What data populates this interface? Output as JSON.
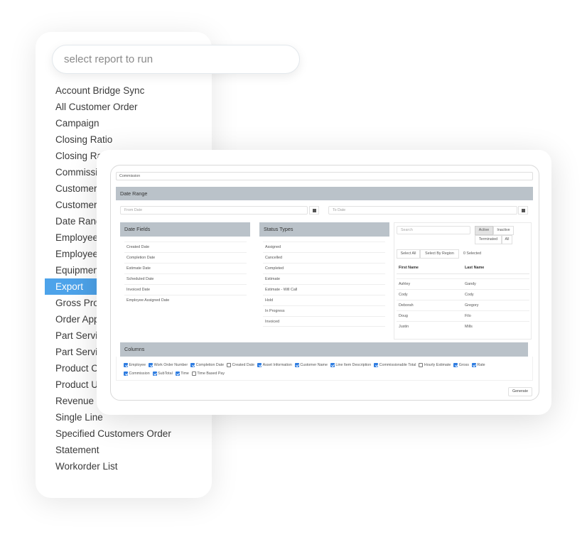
{
  "report_picker": {
    "search_placeholder": "select report to run",
    "items": [
      {
        "label": "Account Bridge Sync",
        "active": false
      },
      {
        "label": "All Customer Order",
        "active": false
      },
      {
        "label": "Campaign",
        "active": false
      },
      {
        "label": "Closing Ratio",
        "active": false
      },
      {
        "label": "Closing Ratio",
        "active": false
      },
      {
        "label": "Commission",
        "active": false
      },
      {
        "label": "Customer",
        "active": false
      },
      {
        "label": "Customers",
        "active": false
      },
      {
        "label": "Date Range",
        "active": false
      },
      {
        "label": "Employee",
        "active": false
      },
      {
        "label": "Employee",
        "active": false
      },
      {
        "label": "Equipment",
        "active": false
      },
      {
        "label": "Export",
        "active": true
      },
      {
        "label": "Gross Profit",
        "active": false
      },
      {
        "label": "Order App",
        "active": false
      },
      {
        "label": "Part Service",
        "active": false
      },
      {
        "label": "Part Service",
        "active": false
      },
      {
        "label": "Product Co",
        "active": false
      },
      {
        "label": "Product Us",
        "active": false
      },
      {
        "label": "Revenue",
        "active": false
      },
      {
        "label": "Single Line",
        "active": false
      },
      {
        "label": "Specified Customers Order",
        "active": false
      },
      {
        "label": "Statement",
        "active": false
      },
      {
        "label": "Workorder List",
        "active": false
      }
    ],
    "active_color": "#4da3ea"
  },
  "form": {
    "report_name": "Commission",
    "date_range": {
      "title": "Date Range",
      "from_placeholder": "From Date",
      "to_placeholder": "To Date"
    },
    "date_fields": {
      "title": "Date Fields",
      "items": [
        "Created Date",
        "Completion Date",
        "Estimate Date",
        "Scheduled Date",
        "Invoiced Date",
        "Employee Assigned Date"
      ]
    },
    "status_types": {
      "title": "Status Types",
      "items": [
        "Assigned",
        "Cancelled",
        "Completed",
        "Estimate",
        "Estimate - Will Call",
        "Hold",
        "In Progress",
        "Invoiced"
      ]
    },
    "employees": {
      "search_placeholder": "Search",
      "filters": {
        "active": "Active",
        "inactive": "Inactive",
        "terminated": "Terminated",
        "all": "All",
        "selected": "Active"
      },
      "select_all": "Select All",
      "select_by_region": "Select By Region",
      "selected_count": "0 Selected",
      "headers": {
        "first": "First Name",
        "last": "Last Name"
      },
      "rows": [
        {
          "first": "Ashley",
          "last": "Gandy"
        },
        {
          "first": "Cody",
          "last": "Cody"
        },
        {
          "first": "Deborah",
          "last": "Gregory"
        },
        {
          "first": "Doug",
          "last": "Filo"
        },
        {
          "first": "Justin",
          "last": "Mills"
        }
      ]
    },
    "columns": {
      "title": "Columns",
      "items": [
        {
          "label": "Employee",
          "checked": true
        },
        {
          "label": "Work Order Number",
          "checked": true
        },
        {
          "label": "Completion Date",
          "checked": true
        },
        {
          "label": "Created Date",
          "checked": false
        },
        {
          "label": "Asset Information",
          "checked": true
        },
        {
          "label": "Customer Name",
          "checked": true
        },
        {
          "label": "Line Item Description",
          "checked": true
        },
        {
          "label": "Commissionable Total",
          "checked": true
        },
        {
          "label": "Hourly Estimate",
          "checked": false
        },
        {
          "label": "Gross",
          "checked": true
        },
        {
          "label": "Rate",
          "checked": true
        },
        {
          "label": "Commission",
          "checked": true
        },
        {
          "label": "SubTotal",
          "checked": true
        },
        {
          "label": "Time",
          "checked": true
        },
        {
          "label": "Time Based Pay",
          "checked": false
        }
      ]
    },
    "generate_label": "Generate",
    "section_color": "#bac2c9",
    "checkbox_color": "#2f7de1"
  }
}
